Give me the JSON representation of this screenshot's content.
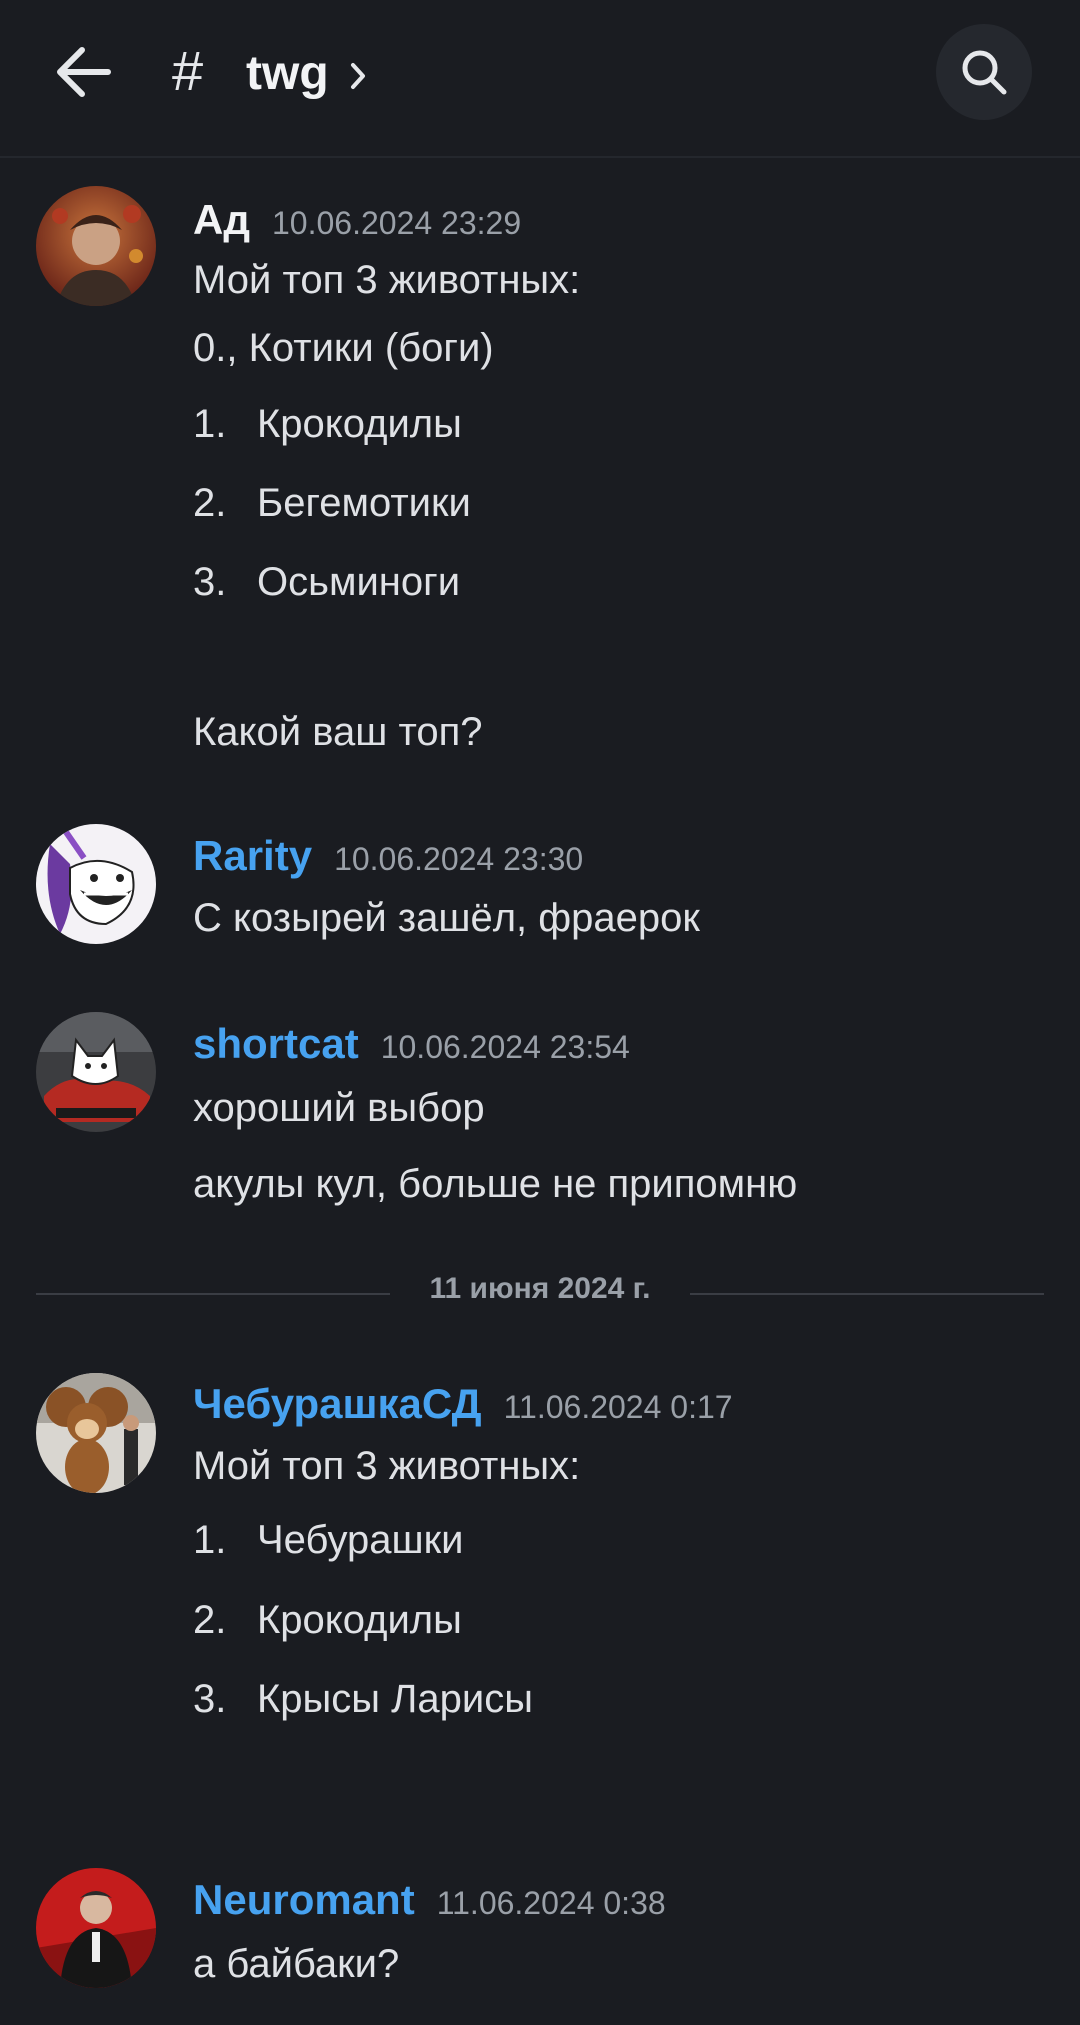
{
  "header": {
    "hash_symbol": "#",
    "channel": "twg"
  },
  "colors": {
    "background": "#1a1c21",
    "link_blue": "#47a2f0",
    "text": "#dfe1e5",
    "muted": "#9aa0a8"
  },
  "messages": [
    {
      "author": "Ад",
      "author_color": "#f2f3f5",
      "time": "10.06.2024 23:29",
      "lines": [
        {
          "num": "",
          "text": "Мой топ 3 животных:"
        },
        {
          "num": "",
          "text": "0., Котики (боги)"
        },
        {
          "num": "1.",
          "text": "Крокодилы"
        },
        {
          "num": "2.",
          "text": "Бегемотики"
        },
        {
          "num": "3.",
          "text": "Осьминоги"
        },
        {
          "num": "",
          "text": "Какой ваш топ?"
        }
      ]
    },
    {
      "author": "Rarity",
      "author_color": "#47a2f0",
      "time": "10.06.2024 23:30",
      "lines": [
        {
          "num": "",
          "text": "С козырей зашёл, фраерок"
        }
      ]
    },
    {
      "author": "shortcat",
      "author_color": "#47a2f0",
      "time": "10.06.2024 23:54",
      "lines": [
        {
          "num": "",
          "text": "хороший выбор"
        },
        {
          "num": "",
          "text": "акулы кул, больше не припомню"
        }
      ]
    },
    {
      "author": "ЧебурашкаСД",
      "author_color": "#47a2f0",
      "time": "11.06.2024 0:17",
      "lines": [
        {
          "num": "",
          "text": "Мой топ 3 животных:"
        },
        {
          "num": "1.",
          "text": "Чебурашки"
        },
        {
          "num": "2.",
          "text": "Крокодилы"
        },
        {
          "num": "3.",
          "text": "Крысы Ларисы"
        }
      ]
    },
    {
      "author": "Neuromant",
      "author_color": "#47a2f0",
      "time": "11.06.2024 0:38",
      "lines": [
        {
          "num": "",
          "text": "а байбаки?"
        }
      ]
    }
  ],
  "date_divider": "11 июня 2024 г."
}
